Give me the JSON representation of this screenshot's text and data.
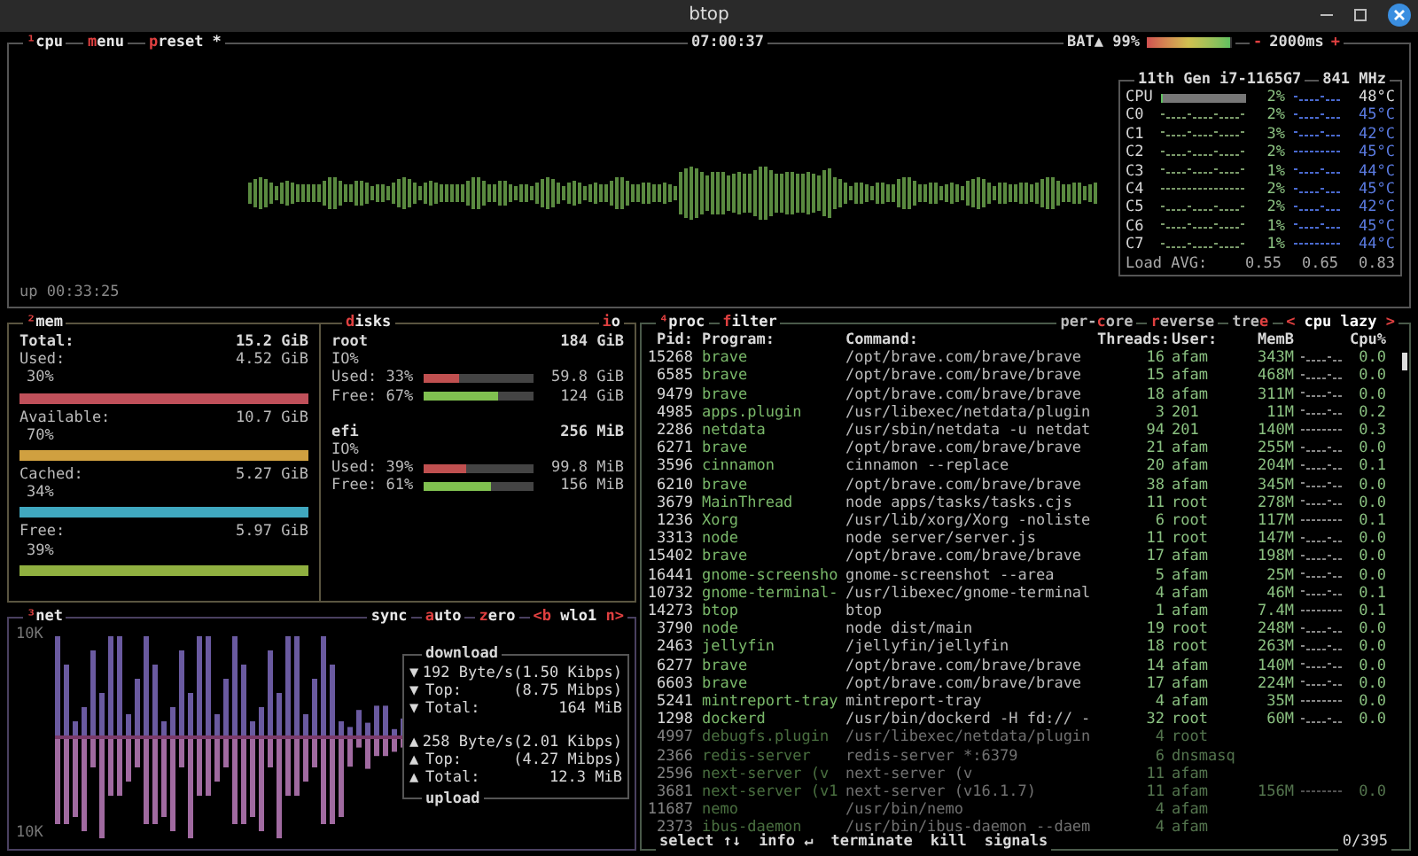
{
  "window": {
    "title": "btop"
  },
  "cpu": {
    "tabs": [
      [
        {
          "text": "¹",
          "hot": true
        },
        {
          "text": "cpu",
          "hot": false
        }
      ],
      [
        {
          "text": "m",
          "hot": true
        },
        {
          "text": "enu",
          "hot": false
        }
      ],
      [
        {
          "text": "p",
          "hot": true
        },
        {
          "text": "reset *",
          "hot": false
        }
      ]
    ],
    "clock": "07:00:37",
    "battery": {
      "label": "BAT▲ 99%",
      "level": 0.99
    },
    "update": {
      "minus": "-",
      "interval": "2000ms",
      "plus": "+"
    },
    "uptime": "up 00:33:25",
    "info": {
      "model": "11th Gen i7-1165G7",
      "freq": "841 MHz",
      "cores": [
        {
          "kind": "total",
          "name": "CPU",
          "level": 0.02,
          "percent": "2%",
          "temp": "48°C"
        },
        {
          "kind": "core",
          "name": "C0",
          "percent": "2%",
          "temp": "45°C"
        },
        {
          "kind": "core",
          "name": "C1",
          "percent": "3%",
          "temp": "42°C"
        },
        {
          "kind": "core",
          "name": "C2",
          "percent": "2%",
          "temp": "45°C"
        },
        {
          "kind": "core",
          "name": "C3",
          "percent": "1%",
          "temp": "44°C"
        },
        {
          "kind": "core",
          "name": "C4",
          "percent": "2%",
          "temp": "45°C"
        },
        {
          "kind": "core",
          "name": "C5",
          "percent": "2%",
          "temp": "42°C"
        },
        {
          "kind": "core",
          "name": "C6",
          "percent": "1%",
          "temp": "45°C"
        },
        {
          "kind": "core",
          "name": "C7",
          "percent": "1%",
          "temp": "44°C"
        }
      ],
      "load_label": "Load AVG:",
      "load": [
        "0.55",
        "0.65",
        "0.83"
      ]
    }
  },
  "mem": {
    "title": [
      {
        "text": "²",
        "hot": true
      },
      {
        "text": "mem",
        "hot": false
      }
    ],
    "total_label": "Total:",
    "total": "15.2 GiB",
    "items": [
      {
        "label": "Used:",
        "value": "4.52 GiB",
        "percent": "30%",
        "color": "#c0505a"
      },
      {
        "label": "Available:",
        "value": "10.7 GiB",
        "percent": "70%",
        "color": "#d0a040"
      },
      {
        "label": "Cached:",
        "value": "5.27 GiB",
        "percent": "34%",
        "color": "#40a8c0"
      },
      {
        "label": "Free:",
        "value": "5.97 GiB",
        "percent": "39%",
        "color": "#90b040"
      }
    ]
  },
  "disks": {
    "title": [
      {
        "text": "d",
        "hot": true
      },
      {
        "text": "isks",
        "hot": false
      }
    ],
    "io_tab": [
      {
        "text": "i",
        "hot": true
      },
      {
        "text": "o",
        "hot": false
      }
    ],
    "items": [
      {
        "name": "root",
        "size": "184 GiB",
        "io": "IO%",
        "meters": [
          {
            "kind": "used",
            "label": "Used: 33%",
            "level": 0.33,
            "value": "59.8 GiB"
          },
          {
            "kind": "free",
            "label": "Free: 67%",
            "level": 0.67,
            "value": "124 GiB"
          }
        ]
      },
      {
        "name": "efi",
        "size": "256 MiB",
        "io": "IO%",
        "meters": [
          {
            "kind": "used",
            "label": "Used: 39%",
            "level": 0.39,
            "value": "99.8 MiB"
          },
          {
            "kind": "free",
            "label": "Free: 61%",
            "level": 0.61,
            "value": "156 MiB"
          }
        ]
      }
    ]
  },
  "net": {
    "title": [
      {
        "text": "³",
        "hot": true
      },
      {
        "text": "net",
        "hot": false
      }
    ],
    "tabs": [
      [
        {
          "text": "sync",
          "hot": false
        }
      ],
      [
        {
          "text": "a",
          "hot": true
        },
        {
          "text": "uto",
          "hot": false
        }
      ],
      [
        {
          "text": "z",
          "hot": true
        },
        {
          "text": "ero",
          "hot": false
        }
      ],
      [
        {
          "text": "<b",
          "hot": true
        },
        {
          "text": " wlo1 ",
          "hot": false
        },
        {
          "text": "n>",
          "hot": true
        }
      ]
    ],
    "scale_top": "10K",
    "scale_bottom": "10K",
    "download_title": "download",
    "upload_title": "upload",
    "rows": [
      {
        "arrow": "▼",
        "label": "192 Byte/s",
        "value": "(1.50 Kibps)"
      },
      {
        "arrow": "▼",
        "label": "Top:",
        "value": "(8.75 Mibps)"
      },
      {
        "arrow": "▼",
        "label": "Total:",
        "value": "164 MiB"
      },
      {
        "arrow": "▲",
        "label": "258 Byte/s",
        "value": "(2.01 Kibps)"
      },
      {
        "arrow": "▲",
        "label": "Top:",
        "value": "(4.27 Mibps)"
      },
      {
        "arrow": "▲",
        "label": "Total:",
        "value": "12.3 MiB"
      }
    ]
  },
  "proc": {
    "title": [
      {
        "text": "⁴",
        "hot": true
      },
      {
        "text": "proc",
        "hot": false
      }
    ],
    "filter": [
      {
        "text": "f",
        "hot": true
      },
      {
        "text": "ilter",
        "hot": false
      }
    ],
    "tabs": [
      [
        {
          "text": "per-",
          "hot": false
        },
        {
          "text": "c",
          "hot": true
        },
        {
          "text": "ore",
          "hot": false
        }
      ],
      [
        {
          "text": "r",
          "hot": true
        },
        {
          "text": "everse",
          "hot": false
        }
      ],
      [
        {
          "text": "tre",
          "hot": false
        },
        {
          "text": "e",
          "hot": true
        }
      ],
      [
        {
          "text": "<",
          "hot": true
        },
        {
          "text": " cpu lazy ",
          "hot": false
        },
        {
          "text": ">",
          "hot": true
        }
      ]
    ],
    "columns": [
      "Pid:",
      "Program:",
      "Command:",
      "Threads:",
      "User:",
      "MemB",
      "Cpu%"
    ],
    "rows": [
      [
        "15268",
        "brave",
        "/opt/brave.com/brave/brave",
        "16",
        "afam",
        "343M",
        "0.0"
      ],
      [
        "6585",
        "brave",
        "/opt/brave.com/brave/brave",
        "15",
        "afam",
        "468M",
        "0.0"
      ],
      [
        "9479",
        "brave",
        "/opt/brave.com/brave/brave",
        "18",
        "afam",
        "311M",
        "0.0"
      ],
      [
        "4985",
        "apps.plugin",
        "/usr/libexec/netdata/plugin",
        "3",
        "201",
        "11M",
        "0.2"
      ],
      [
        "2286",
        "netdata",
        "/usr/sbin/netdata -u netdat",
        "94",
        "201",
        "140M",
        "0.3"
      ],
      [
        "6271",
        "brave",
        "/opt/brave.com/brave/brave",
        "21",
        "afam",
        "255M",
        "0.0"
      ],
      [
        "3596",
        "cinnamon",
        "cinnamon --replace",
        "20",
        "afam",
        "204M",
        "0.1"
      ],
      [
        "6210",
        "brave",
        "/opt/brave.com/brave/brave",
        "38",
        "afam",
        "345M",
        "0.0"
      ],
      [
        "3679",
        "MainThread",
        "node apps/tasks/tasks.cjs",
        "11",
        "root",
        "278M",
        "0.0"
      ],
      [
        "1236",
        "Xorg",
        "/usr/lib/xorg/Xorg -noliste",
        "6",
        "root",
        "117M",
        "0.1"
      ],
      [
        "3313",
        "node",
        "node server/server.js",
        "11",
        "root",
        "147M",
        "0.0"
      ],
      [
        "15402",
        "brave",
        "/opt/brave.com/brave/brave",
        "17",
        "afam",
        "198M",
        "0.0"
      ],
      [
        "16441",
        "gnome-screensho",
        "gnome-screenshot --area",
        "5",
        "afam",
        "25M",
        "0.0"
      ],
      [
        "10732",
        "gnome-terminal-",
        "/usr/libexec/gnome-terminal",
        "4",
        "afam",
        "46M",
        "0.1"
      ],
      [
        "14273",
        "btop",
        "btop",
        "1",
        "afam",
        "7.4M",
        "0.1"
      ],
      [
        "3790",
        "node",
        "node dist/main",
        "19",
        "root",
        "248M",
        "0.0"
      ],
      [
        "2463",
        "jellyfin",
        "/jellyfin/jellyfin",
        "18",
        "root",
        "263M",
        "0.0"
      ],
      [
        "6277",
        "brave",
        "/opt/brave.com/brave/brave",
        "14",
        "afam",
        "140M",
        "0.0"
      ],
      [
        "6603",
        "brave",
        "/opt/brave.com/brave/brave",
        "17",
        "afam",
        "224M",
        "0.0"
      ],
      [
        "5241",
        "mintreport-tray",
        "mintreport-tray",
        "4",
        "afam",
        "35M",
        "0.0"
      ],
      [
        "1298",
        "dockerd",
        "/usr/bin/dockerd -H fd:// -",
        "32",
        "root",
        "60M",
        "0.0"
      ],
      [
        "4997",
        "debugfs.plugin",
        "/usr/libexec/netdata/plugin",
        "4",
        "root"
      ],
      [
        "2366",
        "redis-server",
        "redis-server *:6379",
        "6",
        "dnsmasq"
      ],
      [
        "2596",
        "next-server (v",
        "next-server (v",
        "11",
        "afam"
      ],
      [
        "3681",
        "next-server (v1",
        "next-server (v16.1.7)",
        "11",
        "afam",
        "156M",
        "0.0"
      ],
      [
        "11687",
        "nemo",
        "/usr/bin/nemo",
        "4",
        "afam"
      ],
      [
        "2373",
        "ibus-daemon",
        "/usr/bin/ibus-daemon --daem",
        "4",
        "afam"
      ]
    ],
    "footer": [
      "select ↑↓",
      "info ↵",
      "terminate",
      "kill",
      "signals"
    ],
    "count": "0/395"
  }
}
